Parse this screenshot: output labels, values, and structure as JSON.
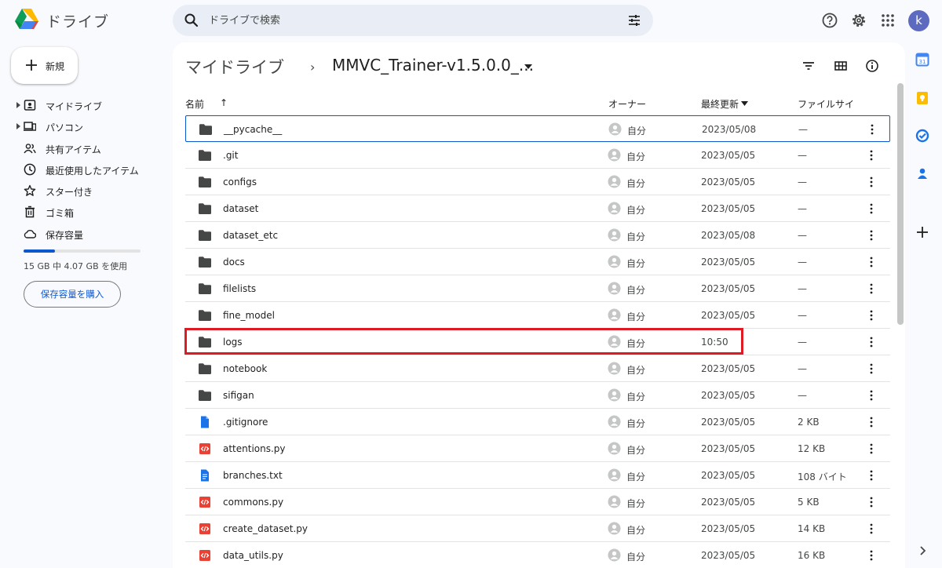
{
  "app": {
    "name": "ドライブ",
    "colors": {
      "accent": "#0b57d0",
      "folder": "#444746",
      "highlight": "#e01a22"
    }
  },
  "search": {
    "placeholder": "ドライブで検索",
    "value": ""
  },
  "header_icons": [
    "help-icon",
    "settings-icon",
    "apps-grid-icon"
  ],
  "user": {
    "avatar_letter": "k",
    "avatar_color": "#5c6bc0"
  },
  "sidebar": {
    "new_label": "新規",
    "items": [
      {
        "label": "マイドライブ",
        "icon": "my-drive-icon",
        "expandable": true
      },
      {
        "label": "パソコン",
        "icon": "computers-icon",
        "expandable": true
      },
      {
        "label": "共有アイテム",
        "icon": "shared-icon",
        "expandable": false
      },
      {
        "label": "最近使用したアイテム",
        "icon": "recent-icon",
        "expandable": false
      },
      {
        "label": "スター付き",
        "icon": "star-icon",
        "expandable": false
      },
      {
        "label": "ゴミ箱",
        "icon": "trash-icon",
        "expandable": false
      },
      {
        "label": "保存容量",
        "icon": "cloud-icon",
        "expandable": false
      }
    ],
    "storage": {
      "text": "15 GB 中 4.07 GB を使用",
      "used_fraction": 0.27
    },
    "buy_storage_label": "保存容量を購入"
  },
  "breadcrumb": {
    "root": "マイドライブ",
    "separator": "›",
    "current": "MMVC_Trainer-v1.5.0.0_..."
  },
  "view_icons": [
    "filter-icon",
    "grid-view-icon",
    "info-icon"
  ],
  "columns": {
    "name": "名前",
    "sort_arrow": "↑",
    "owner": "オーナー",
    "modified": "最終更新",
    "size": "ファイルサイ"
  },
  "files": [
    {
      "name": "__pycache__",
      "type": "folder",
      "owner": "自分",
      "modified": "2023/05/08",
      "size": "—",
      "selected": true
    },
    {
      "name": ".git",
      "type": "folder",
      "owner": "自分",
      "modified": "2023/05/05",
      "size": "—"
    },
    {
      "name": "configs",
      "type": "folder",
      "owner": "自分",
      "modified": "2023/05/05",
      "size": "—"
    },
    {
      "name": "dataset",
      "type": "folder",
      "owner": "自分",
      "modified": "2023/05/05",
      "size": "—"
    },
    {
      "name": "dataset_etc",
      "type": "folder",
      "owner": "自分",
      "modified": "2023/05/08",
      "size": "—"
    },
    {
      "name": "docs",
      "type": "folder",
      "owner": "自分",
      "modified": "2023/05/05",
      "size": "—"
    },
    {
      "name": "filelists",
      "type": "folder",
      "owner": "自分",
      "modified": "2023/05/05",
      "size": "—"
    },
    {
      "name": "fine_model",
      "type": "folder",
      "owner": "自分",
      "modified": "2023/05/05",
      "size": "—"
    },
    {
      "name": "logs",
      "type": "folder",
      "owner": "自分",
      "modified": "10:50",
      "size": "—",
      "highlighted": true
    },
    {
      "name": "notebook",
      "type": "folder",
      "owner": "自分",
      "modified": "2023/05/05",
      "size": "—"
    },
    {
      "name": "sifigan",
      "type": "folder",
      "owner": "自分",
      "modified": "2023/05/05",
      "size": "—"
    },
    {
      "name": ".gitignore",
      "type": "doc",
      "owner": "自分",
      "modified": "2023/05/05",
      "size": "2 KB"
    },
    {
      "name": "attentions.py",
      "type": "code",
      "owner": "自分",
      "modified": "2023/05/05",
      "size": "12 KB"
    },
    {
      "name": "branches.txt",
      "type": "text",
      "owner": "自分",
      "modified": "2023/05/05",
      "size": "108 バイト"
    },
    {
      "name": "commons.py",
      "type": "code",
      "owner": "自分",
      "modified": "2023/05/05",
      "size": "5 KB"
    },
    {
      "name": "create_dataset.py",
      "type": "code",
      "owner": "自分",
      "modified": "2023/05/05",
      "size": "14 KB"
    },
    {
      "name": "data_utils.py",
      "type": "code",
      "owner": "自分",
      "modified": "2023/05/05",
      "size": "16 KB"
    }
  ],
  "right_rail": [
    "calendar-icon",
    "keep-icon",
    "tasks-icon",
    "contacts-icon",
    "add-addon-icon",
    "expand-panel-icon"
  ]
}
